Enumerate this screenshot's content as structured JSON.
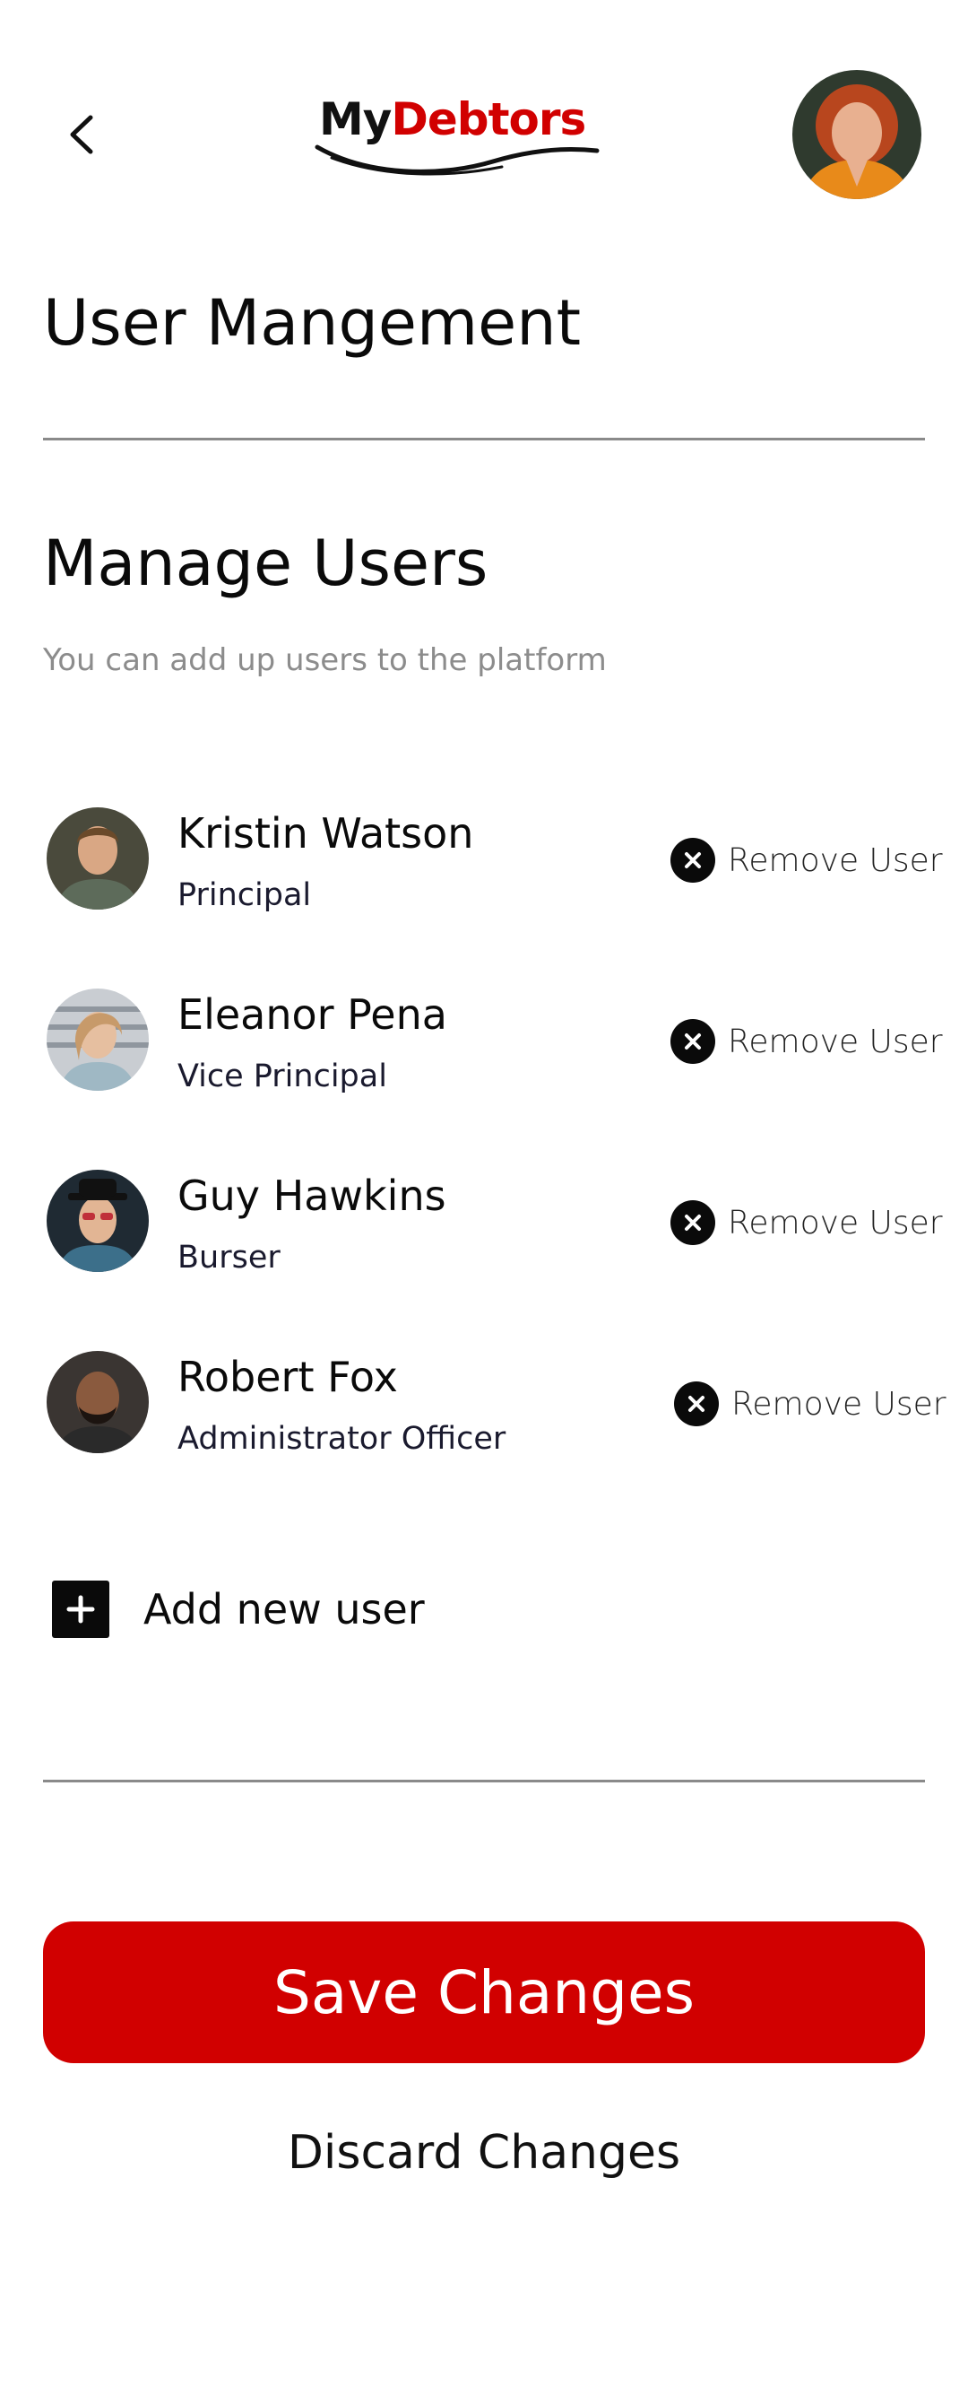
{
  "header": {
    "logo": {
      "part1": "My",
      "part2": "Debtors"
    },
    "back_icon": "chevron-left-icon",
    "profile_avatar": "profile-photo"
  },
  "page": {
    "title": "User Mangement"
  },
  "manage": {
    "title": "Manage Users",
    "subtitle": "You can add up users to the platform"
  },
  "users": [
    {
      "name": "Kristin Watson",
      "role": "Principal",
      "remove_label": "Remove User",
      "avatar": "user-photo"
    },
    {
      "name": "Eleanor Pena",
      "role": "Vice Principal",
      "remove_label": "Remove User",
      "avatar": "user-photo"
    },
    {
      "name": "Guy Hawkins",
      "role": "Burser",
      "remove_label": "Remove User",
      "avatar": "user-photo"
    },
    {
      "name": "Robert Fox",
      "role": "Administrator Officer",
      "remove_label": "Remove User",
      "avatar": "user-photo"
    }
  ],
  "add_user": {
    "label": "Add new user",
    "icon": "plus-square-icon"
  },
  "actions": {
    "save_label": "Save Changes",
    "discard_label": "Discard Changes"
  },
  "colors": {
    "brand_red": "#d10000",
    "text": "#0a0a0a",
    "muted": "#8c8c8c",
    "divider": "#8a8a8a"
  }
}
